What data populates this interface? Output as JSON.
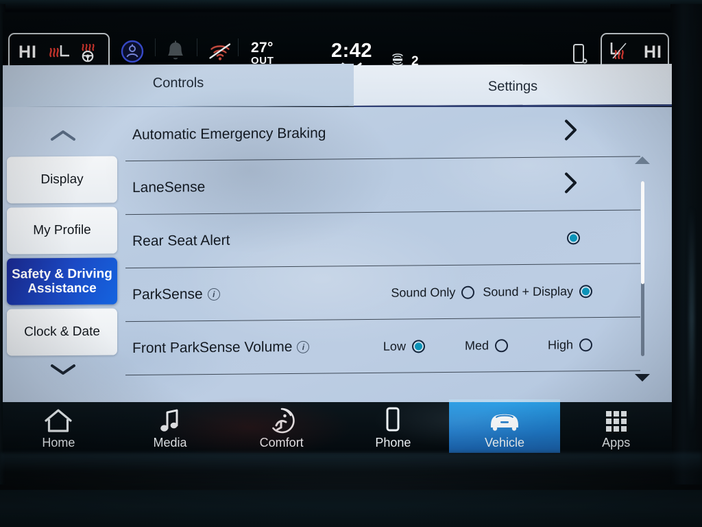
{
  "status_bar": {
    "left_climate": {
      "level": "HI",
      "seat_heat_icon": "heated-seat-icon",
      "steering_wheel_heat_icon": "heated-steering-wheel-icon"
    },
    "profile_icon": "driver-profile-icon",
    "notification_icon": "bell-icon",
    "wifi_icon": "wifi-off-icon",
    "temperature": "27°",
    "temperature_label": "OUT",
    "clock": "2:42",
    "clock_chevron_icon": "chevron-down-icon",
    "satellite_radio_icon": "siriusxm-icon",
    "satellite_radio_channel": "2",
    "phone_icon": "phone-device-icon",
    "right_climate": {
      "level": "HI",
      "seat_heat_icon": "heated-seat-icon"
    }
  },
  "tabs": [
    {
      "label": "Controls",
      "active": false
    },
    {
      "label": "Settings",
      "active": true
    }
  ],
  "sidebar": {
    "scroll_up_icon": "chevron-up-icon",
    "scroll_down_icon": "chevron-down-icon",
    "items": [
      {
        "label": "Display",
        "selected": false
      },
      {
        "label": "My Profile",
        "selected": false
      },
      {
        "label": "Safety & Driving Assistance",
        "selected": true
      },
      {
        "label": "Clock & Date",
        "selected": false
      }
    ]
  },
  "settings_list": {
    "rows": [
      {
        "label": "Automatic Emergency Braking",
        "control": "chevron",
        "chevron_icon": "chevron-right-icon"
      },
      {
        "label": "LaneSense",
        "control": "chevron",
        "chevron_icon": "chevron-right-icon"
      },
      {
        "label": "Rear Seat Alert",
        "control": "toggle-radio",
        "selected": true
      },
      {
        "label": "ParkSense",
        "info_icon": "info-icon",
        "control": "radio-group",
        "options": [
          {
            "label": "Sound Only",
            "selected": false
          },
          {
            "label": "Sound + Display",
            "selected": true
          }
        ]
      },
      {
        "label": "Front ParkSense Volume",
        "info_icon": "info-icon",
        "control": "radio-group",
        "options": [
          {
            "label": "Low",
            "selected": true
          },
          {
            "label": "Med",
            "selected": false
          },
          {
            "label": "High",
            "selected": false
          }
        ]
      }
    ]
  },
  "scrollbar": {
    "up_icon": "triangle-up-icon",
    "down_icon": "triangle-down-icon"
  },
  "bottom_nav": [
    {
      "label": "Home",
      "icon": "home-icon",
      "active": false
    },
    {
      "label": "Media",
      "icon": "music-note-icon",
      "active": false
    },
    {
      "label": "Comfort",
      "icon": "comfort-climate-icon",
      "active": false
    },
    {
      "label": "Phone",
      "icon": "phone-icon",
      "active": false
    },
    {
      "label": "Vehicle",
      "icon": "car-front-icon",
      "active": true
    },
    {
      "label": "Apps",
      "icon": "apps-grid-icon",
      "active": false
    }
  ],
  "colors": {
    "accent_selected": "#0c93b8",
    "sidebar_selected": "#1b49c4",
    "nav_active": "#1f7ccb",
    "panel_background": "#bccde3"
  }
}
